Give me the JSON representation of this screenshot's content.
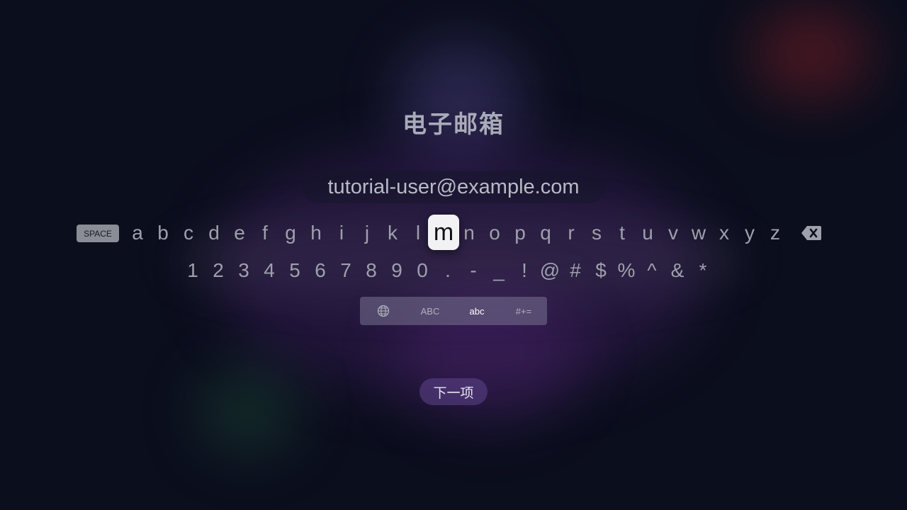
{
  "screen": {
    "title": "电子邮箱",
    "email_value": "tutorial-user@example.com",
    "next_label": "下一项"
  },
  "keyboard": {
    "space_label": "SPACE",
    "letters": [
      "a",
      "b",
      "c",
      "d",
      "e",
      "f",
      "g",
      "h",
      "i",
      "j",
      "k",
      "l",
      "m",
      "n",
      "o",
      "p",
      "q",
      "r",
      "s",
      "t",
      "u",
      "v",
      "w",
      "x",
      "y",
      "z"
    ],
    "focused_key": "m",
    "symbols": [
      "1",
      "2",
      "3",
      "4",
      "5",
      "6",
      "7",
      "8",
      "9",
      "0",
      ".",
      "-",
      "_",
      "!",
      "@",
      "#",
      "$",
      "%",
      "^",
      "&",
      "*"
    ],
    "modes": [
      "globe-icon",
      "ABC",
      "abc",
      "#+="
    ],
    "active_mode": "abc",
    "delete_icon": "backspace-icon"
  },
  "colors": {
    "background": "#0b0e1d",
    "focus_key": "#f2f2f5",
    "next_button": "#5f468c"
  }
}
